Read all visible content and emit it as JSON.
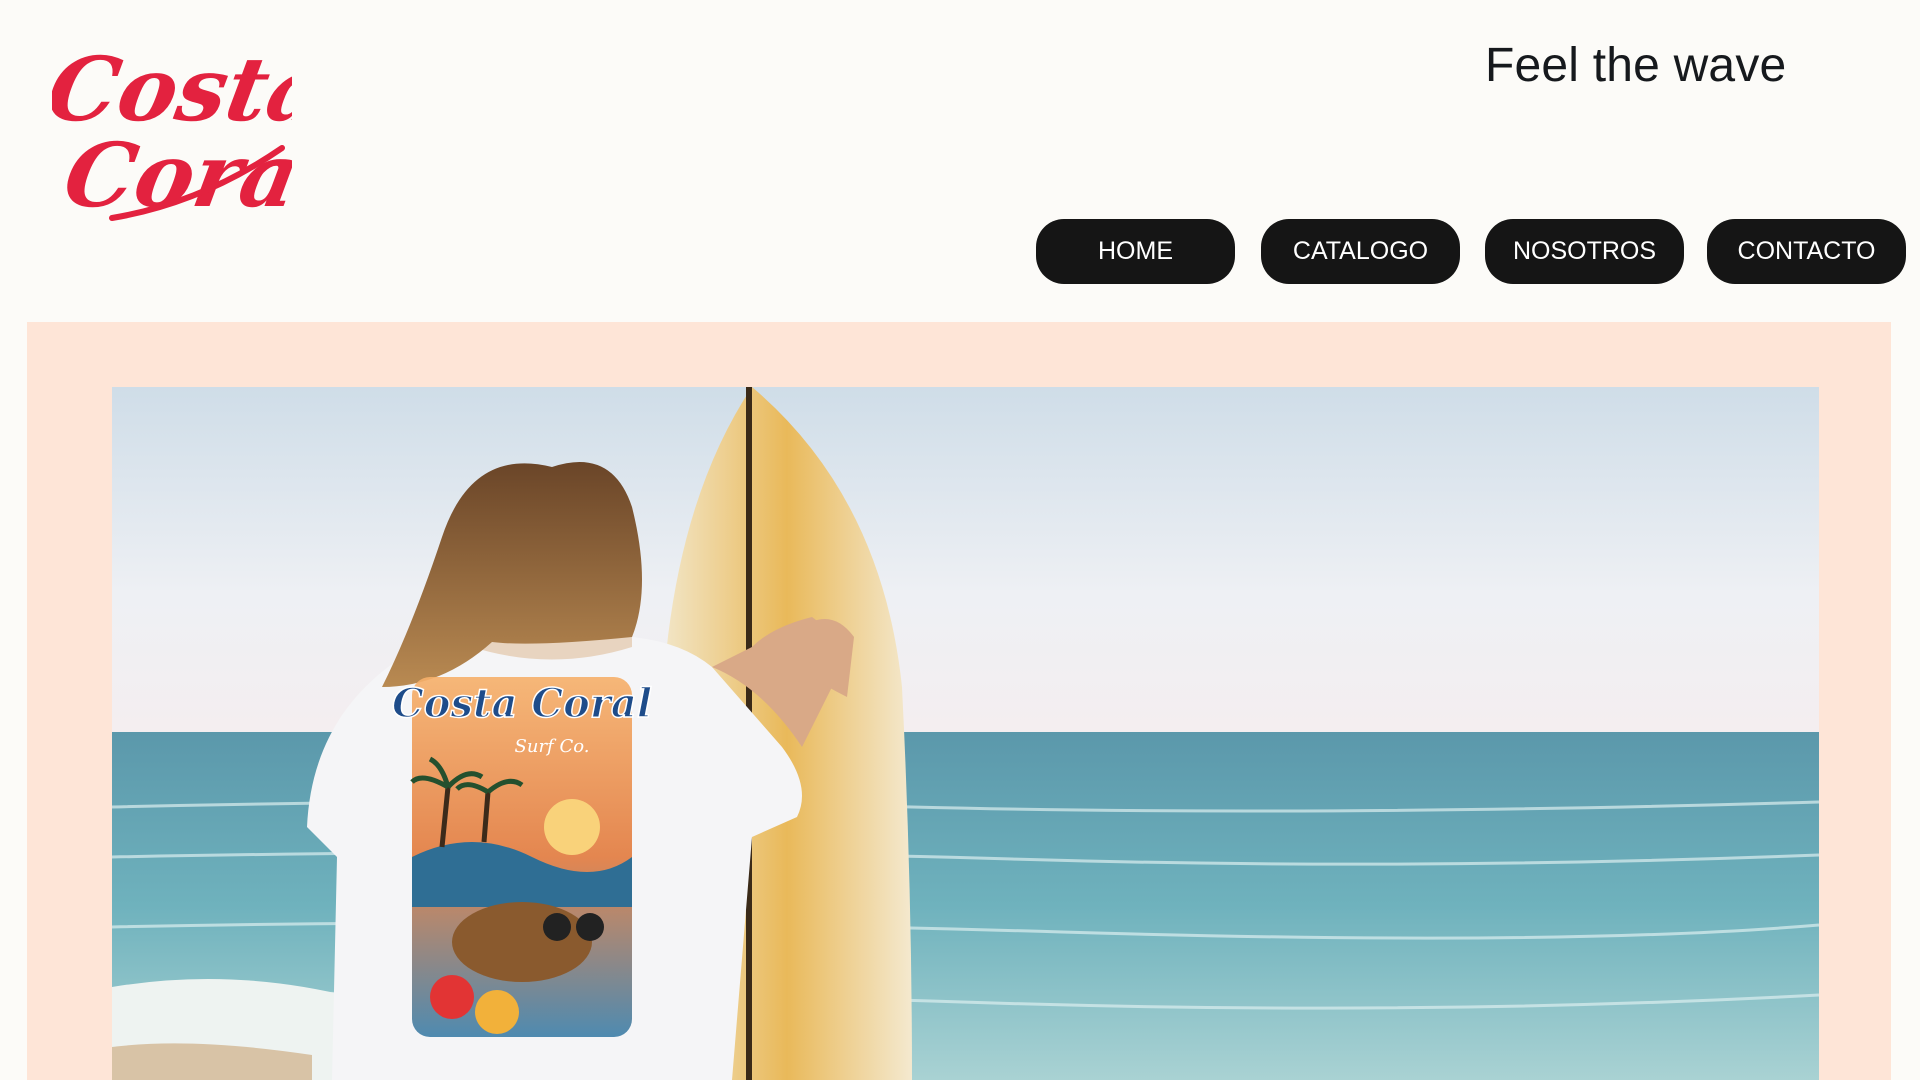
{
  "brand": {
    "logo_line1": "Costa",
    "logo_line2": "Coral",
    "logo_color": "#e3223f"
  },
  "header": {
    "tagline": "Feel the wave"
  },
  "nav": {
    "items": [
      {
        "label": "HOME"
      },
      {
        "label": "CATALOGO"
      },
      {
        "label": "NOSOTROS"
      },
      {
        "label": "CONTACTO"
      }
    ]
  },
  "hero": {
    "panel_color": "#fee5d7",
    "shirt_print_title": "Costa Coral",
    "shirt_print_subtitle": "Surf Co."
  }
}
